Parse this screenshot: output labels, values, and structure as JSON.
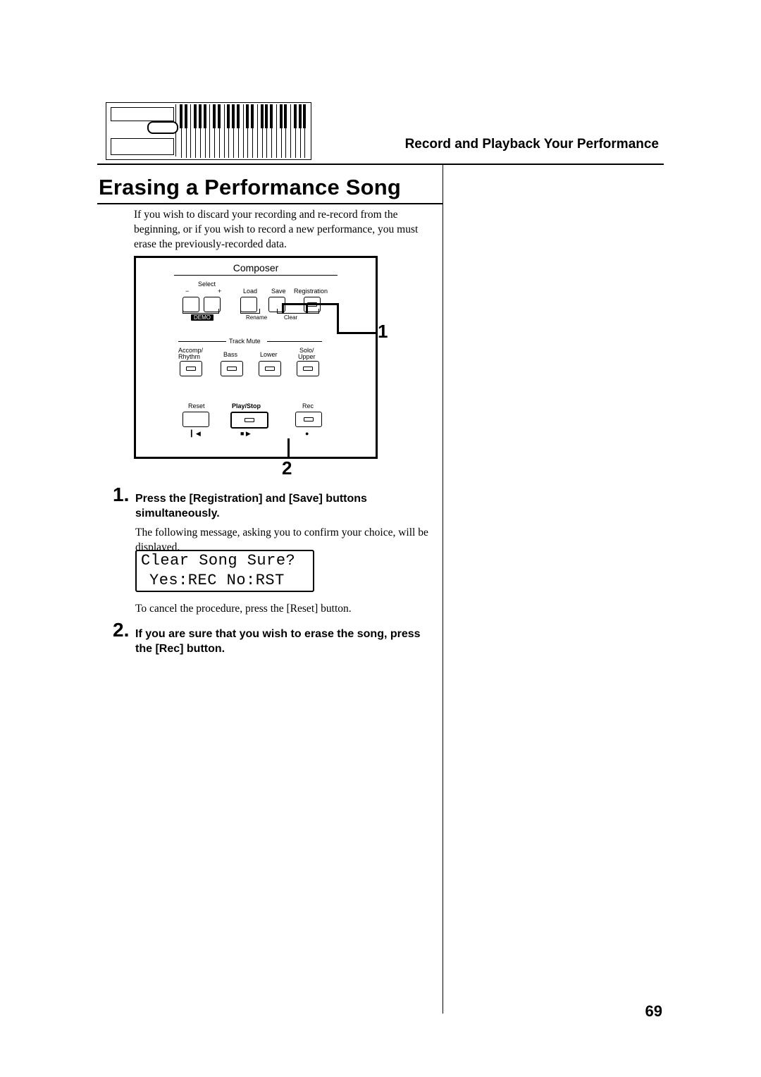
{
  "header": {
    "section_title": "Record and Playback Your Performance",
    "page_title": "Erasing a Performance Song",
    "page_number": "69"
  },
  "intro": "If you wish to discard your recording and re-record from the beginning, or if you wish to record a new performance, you must erase the previously-recorded data.",
  "panel": {
    "title": "Composer",
    "select": "Select",
    "minus": "−",
    "plus": "+",
    "load": "Load",
    "save": "Save",
    "registration": "Registration",
    "demo": "DEMO",
    "rename": "Rename",
    "clear": "Clear",
    "track_mute": "Track Mute",
    "accomp": "Accomp/",
    "rhythm": "Rhythm",
    "bass": "Bass",
    "lower": "Lower",
    "solo": "Solo/",
    "upper": "Upper",
    "reset": "Reset",
    "playstop": "Play/Stop",
    "rec": "Rec"
  },
  "callouts": {
    "one": "1",
    "two": "2"
  },
  "steps": [
    {
      "num": "1.",
      "bold": "Press the [Registration] and [Save] buttons simultaneously.",
      "text1": "The following message, asking you to confirm your choice, will be displayed.",
      "text2": "To cancel the procedure, press the [Reset] button."
    },
    {
      "num": "2.",
      "bold": "If you are sure that you wish to erase the song, press the [Rec] button."
    }
  ],
  "lcd": {
    "line1": "Clear Song Sure?",
    "line2": "Yes:REC No:RST"
  }
}
